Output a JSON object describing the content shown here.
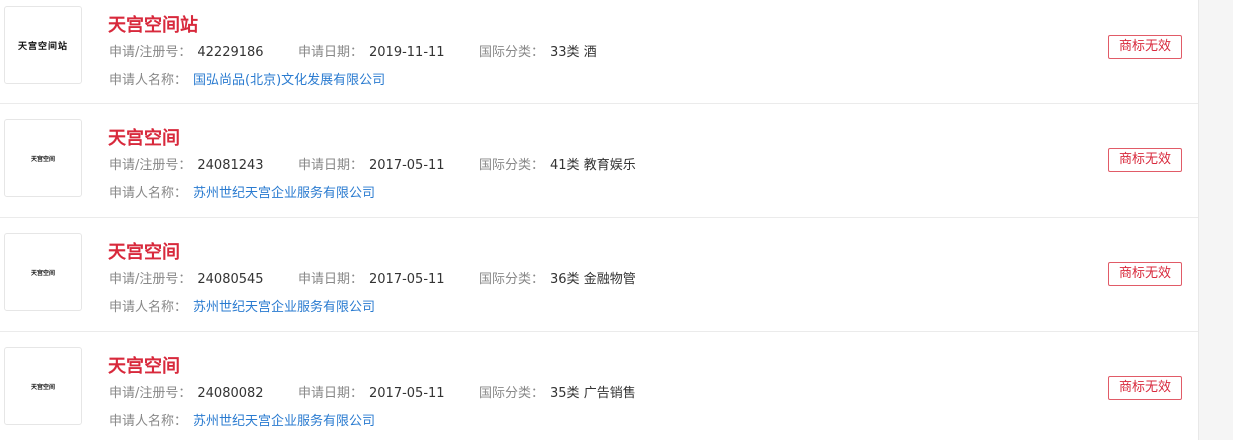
{
  "labels": {
    "reg_no": "申请/注册号：",
    "apply_date": "申请日期：",
    "intl_class": "国际分类：",
    "applicant": "申请人名称："
  },
  "colors": {
    "title": "#d8293c",
    "link": "#2a7bd0",
    "status_border": "#e15b67",
    "label": "#888888"
  },
  "items": [
    {
      "logo_text": "天宫空间站",
      "title": "天宫空间站",
      "reg_no": "42229186",
      "apply_date": "2019-11-11",
      "intl_class": "33类 酒",
      "applicant": "国弘尚品(北京)文化发展有限公司",
      "status": "商标无效"
    },
    {
      "logo_text": "天宫空间",
      "title": "天宫空间",
      "reg_no": "24081243",
      "apply_date": "2017-05-11",
      "intl_class": "41类 教育娱乐",
      "applicant": "苏州世纪天宫企业服务有限公司",
      "status": "商标无效"
    },
    {
      "logo_text": "天宫空间",
      "title": "天宫空间",
      "reg_no": "24080545",
      "apply_date": "2017-05-11",
      "intl_class": "36类 金融物管",
      "applicant": "苏州世纪天宫企业服务有限公司",
      "status": "商标无效"
    },
    {
      "logo_text": "天宫空间",
      "title": "天宫空间",
      "reg_no": "24080082",
      "apply_date": "2017-05-11",
      "intl_class": "35类 广告销售",
      "applicant": "苏州世纪天宫企业服务有限公司",
      "status": "商标无效"
    }
  ]
}
